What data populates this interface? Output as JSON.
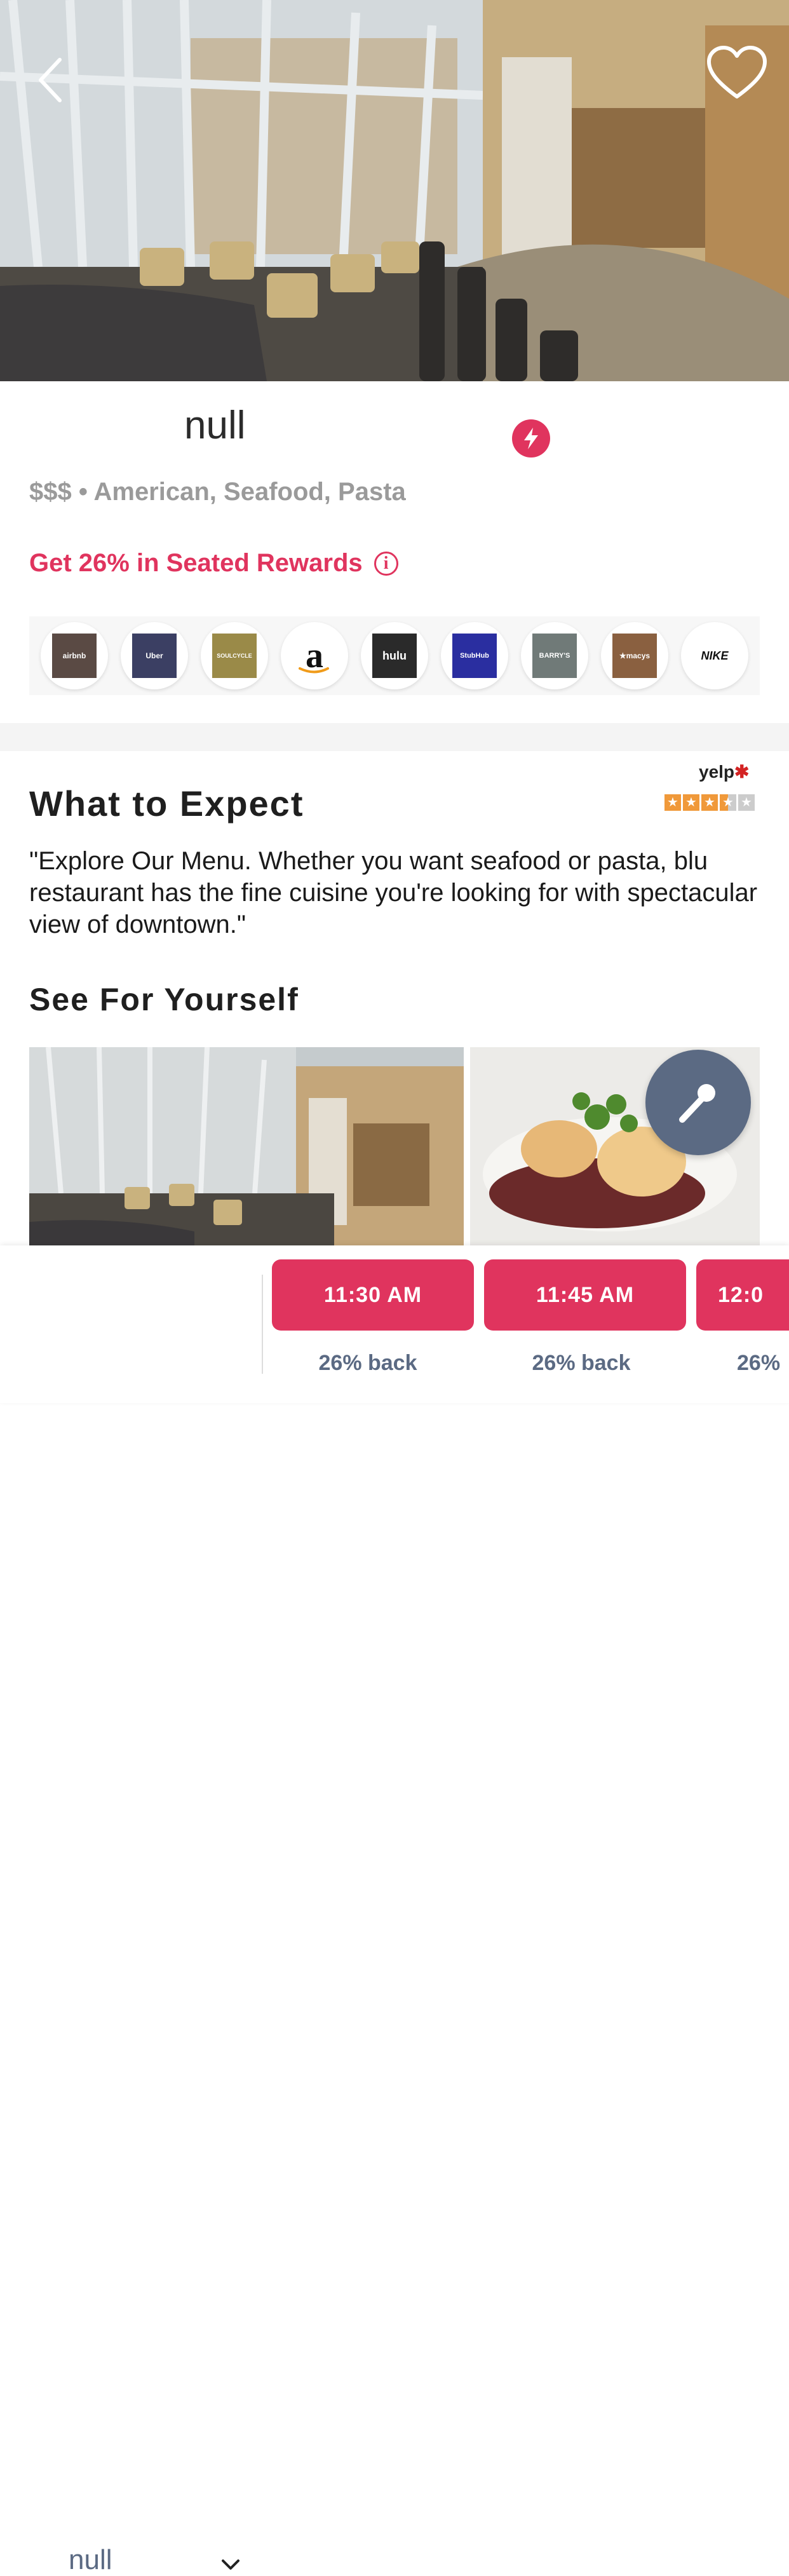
{
  "header": {
    "back_icon": "chevron-left-icon",
    "favorite_icon": "heart-outline-icon"
  },
  "restaurant": {
    "name": "null",
    "badge_icon": "lightning-bolt-icon",
    "meta": "$$$ • American, Seafood, Pasta",
    "rewards": "Get 26% in Seated Rewards",
    "rewards_info_icon": "info-icon",
    "accent_color": "#e0345e"
  },
  "partners": [
    {
      "name": "airbnb",
      "label": "airbnb",
      "bg": "#5a4a44"
    },
    {
      "name": "uber",
      "label": "Uber",
      "bg": "#3b3f63"
    },
    {
      "name": "soulcycle",
      "label": "SOULCYCLE",
      "bg": "#9a8a48"
    },
    {
      "name": "amazon",
      "label": "a",
      "bg": "#ffffff"
    },
    {
      "name": "hulu",
      "label": "hulu",
      "bg": "#2a2a2a"
    },
    {
      "name": "stubhub",
      "label": "StubHub",
      "bg": "#2a2ea0"
    },
    {
      "name": "barrys",
      "label": "BARRY'S",
      "bg": "#707a78"
    },
    {
      "name": "macys",
      "label": "★macys",
      "bg": "#8a6040"
    },
    {
      "name": "nike",
      "label": "NIKE",
      "bg": "#ffffff"
    }
  ],
  "expect": {
    "title": "What to Expect",
    "yelp_label": "yelp",
    "yelp_rating": 3.5,
    "quote": "\"Explore Our Menu. Whether you want seafood or pasta, blu restaurant has the fine cuisine you're looking for with spectacular view of downtown.\""
  },
  "gallery": {
    "title": "See For Yourself",
    "mic_icon": "microphone-icon"
  },
  "booking": {
    "party_value": "null",
    "party_chevron_icon": "chevron-down-icon",
    "slots": [
      {
        "time": "11:30 AM",
        "back": "26% back"
      },
      {
        "time": "11:45 AM",
        "back": "26% back"
      },
      {
        "time": "12:0",
        "back": "26%"
      }
    ]
  }
}
